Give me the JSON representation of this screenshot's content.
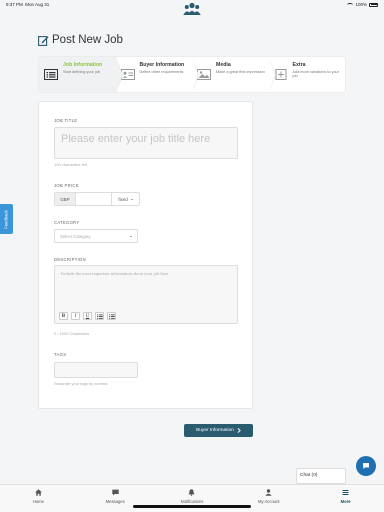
{
  "status_bar": {
    "time": "9:37 PM",
    "date": "Mon Aug 31",
    "battery": "100%"
  },
  "colors": {
    "accent_green": "#8dc63f",
    "brand_dark": "#2b5b6f",
    "chat_blue": "#1f6fb3",
    "feedback_blue": "#3a96d8"
  },
  "page": {
    "title": "Post New Job"
  },
  "steps": [
    {
      "label": "Job Information",
      "sub": "Start defining your job",
      "icon": "job-info-icon",
      "active": true
    },
    {
      "label": "Buyer Information",
      "sub": "Define other requirements",
      "icon": "buyer-card-icon",
      "active": false
    },
    {
      "label": "Media",
      "sub": "Make a great first impression",
      "icon": "image-icon",
      "active": false
    },
    {
      "label": "Extra",
      "sub": "Add more variations to your job",
      "icon": "plus-square-icon",
      "active": false
    }
  ],
  "form": {
    "job_title": {
      "label": "JOB TITLE",
      "placeholder": "Please enter your job title here",
      "hint": "100 characters left"
    },
    "job_price": {
      "label": "JOB PRICE",
      "currency": "GBP",
      "amount": "",
      "unit": "fixed"
    },
    "category": {
      "label": "CATEGORY",
      "placeholder": "Select Category"
    },
    "description": {
      "label": "DESCRIPTION",
      "placeholder": "Include the most important information about your job here.",
      "counter": "0 / 1000 Characters",
      "toolbar": [
        "B",
        "I",
        "U",
        "ordered-list",
        "unordered-list"
      ]
    },
    "tags": {
      "label": "TAGS",
      "hint": "Separate your tags by comma"
    }
  },
  "next_button": {
    "label": "Buyer Information"
  },
  "feedback_tab": {
    "label": "Feedback"
  },
  "chat": {
    "label": "Chat (0)"
  },
  "bottom_nav": [
    {
      "label": "Home",
      "icon": "home-icon",
      "active": false
    },
    {
      "label": "Messages",
      "icon": "message-icon",
      "active": false
    },
    {
      "label": "Notifications",
      "icon": "bell-icon",
      "active": false
    },
    {
      "label": "My Account",
      "icon": "user-icon",
      "active": false
    },
    {
      "label": "More",
      "icon": "menu-icon",
      "active": true
    }
  ]
}
